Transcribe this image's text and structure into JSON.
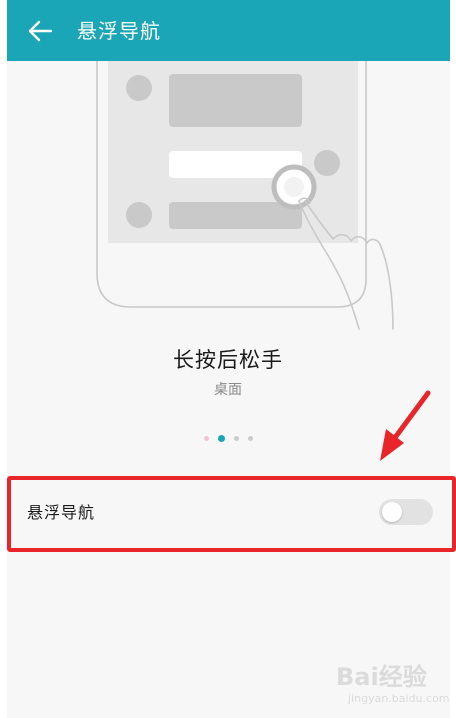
{
  "header": {
    "title": "悬浮导航",
    "back_icon": "arrow-left-icon",
    "background": "#1aa6b6"
  },
  "gesture": {
    "title": "长按后松手",
    "subtitle": "桌面"
  },
  "pager": {
    "count": 4,
    "active_index": 1
  },
  "setting": {
    "label": "悬浮导航",
    "toggle_on": false
  },
  "annotation": {
    "color": "#e8262a"
  },
  "watermark": {
    "logo": "Bai经验",
    "url": "jingyan.baidu.com"
  }
}
